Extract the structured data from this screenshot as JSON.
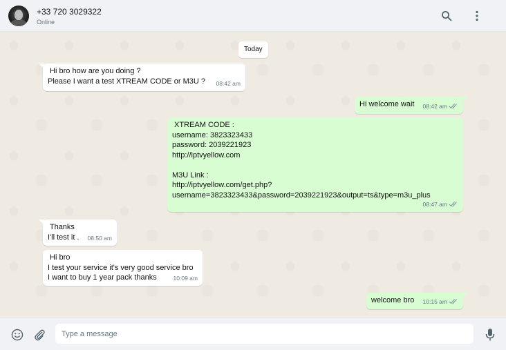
{
  "header": {
    "contact_name": "+33 720 3029322",
    "status": "Online",
    "icons": [
      "search-icon",
      "menu-dots-icon"
    ]
  },
  "chat": {
    "date_chip": "Today",
    "messages": [
      {
        "direction": "incoming",
        "lines": [
          " Hi bro how are you doing ?",
          "Please I want a test XTREAM CODE or M3U ?"
        ],
        "time": "08:42 am",
        "ticks": false
      },
      {
        "direction": "outgoing",
        "lines": [
          "Hi welcome wait"
        ],
        "time": "08:42 am",
        "ticks": true
      },
      {
        "direction": "outgoing",
        "lines": [
          " XTREAM CODE :",
          "username: 3823323433",
          "password: 2039221923",
          "http://iptvyellow.com",
          "",
          "M3U Link :",
          "http://iptvyellow.com/get.php?",
          "username=3823323433&password=2039221923&output=ts&type=m3u_plus"
        ],
        "time": "08:47 am",
        "ticks": true
      },
      {
        "direction": "incoming",
        "lines": [
          " Thanks",
          "I'll test it ."
        ],
        "time": "08:50 am",
        "ticks": false
      },
      {
        "direction": "incoming",
        "lines": [
          " Hi bro",
          "I test your service it's very good service bro",
          "I want to buy 1 year pack thanks"
        ],
        "time": "10:09 am",
        "ticks": false
      },
      {
        "direction": "outgoing",
        "lines": [
          "welcome bro"
        ],
        "time": "10:15 am",
        "ticks": true
      }
    ]
  },
  "footer": {
    "input_placeholder": "Type a message",
    "input_value": "",
    "icons": [
      "emoji-icon",
      "attach-icon",
      "microphone-icon"
    ]
  },
  "colors": {
    "chat_background": "#efeae2",
    "incoming_bubble": "#ffffff",
    "outgoing_bubble": "#d9fdd3",
    "header_background": "#f0f2f5",
    "read_ticks": "#8696a0"
  }
}
